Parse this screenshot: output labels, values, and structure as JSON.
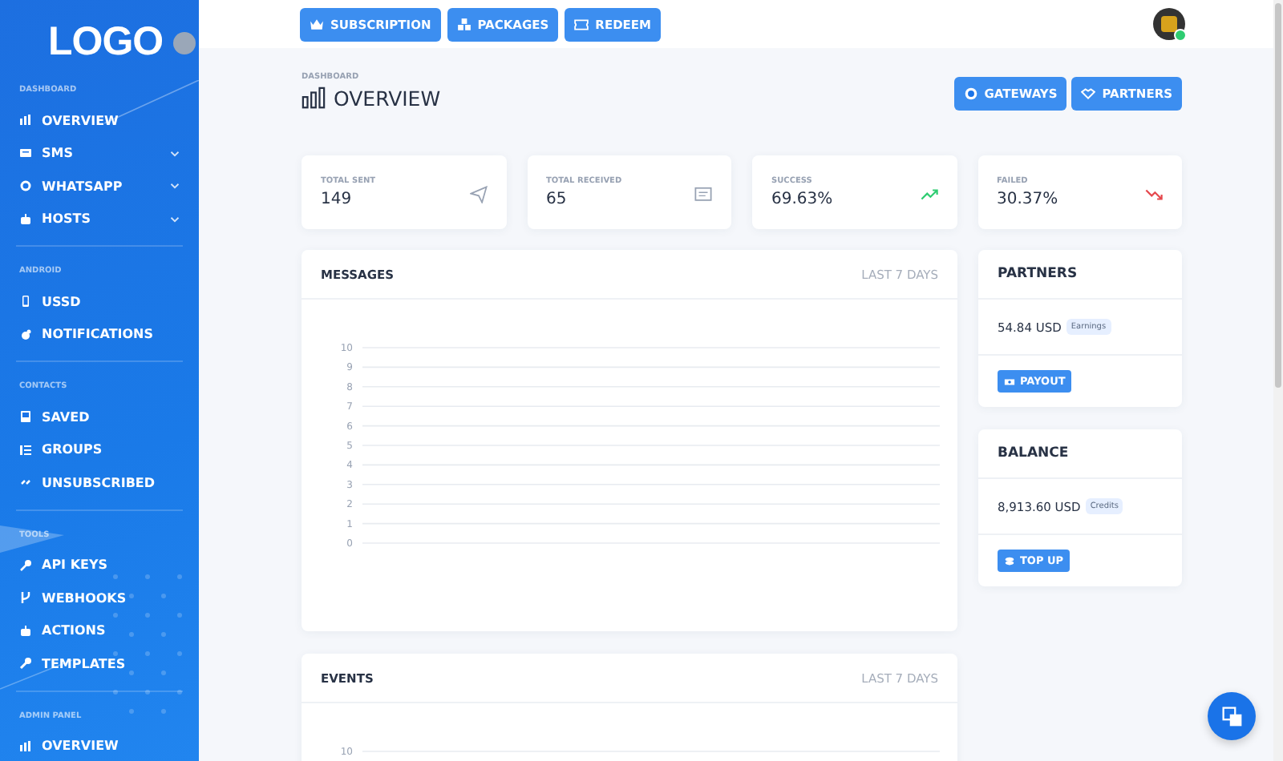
{
  "sidebar": {
    "logo": "LOGO",
    "sections": [
      {
        "title": "DASHBOARD",
        "items": [
          {
            "label": "OVERVIEW"
          },
          {
            "label": "SMS",
            "expanded": false
          },
          {
            "label": "WHATSAPP",
            "expanded": false
          },
          {
            "label": "HOSTS",
            "expanded": false
          }
        ]
      },
      {
        "title": "ANDROID",
        "items": [
          {
            "label": "USSD"
          },
          {
            "label": "NOTIFICATIONS"
          }
        ]
      },
      {
        "title": "CONTACTS",
        "items": [
          {
            "label": "SAVED"
          },
          {
            "label": "GROUPS"
          },
          {
            "label": "UNSUBSCRIBED"
          }
        ]
      },
      {
        "title": "TOOLS",
        "items": [
          {
            "label": "API KEYS"
          },
          {
            "label": "WEBHOOKS"
          },
          {
            "label": "ACTIONS"
          },
          {
            "label": "TEMPLATES"
          }
        ]
      },
      {
        "title": "ADMIN PANEL",
        "items": [
          {
            "label": "OVERVIEW"
          }
        ]
      }
    ]
  },
  "topbar": {
    "buttons": [
      "SUBSCRIPTION",
      "PACKAGES",
      "REDEEM"
    ],
    "user": {
      "online": true
    }
  },
  "header": {
    "breadcrumb": "DASHBOARD",
    "title": "OVERVIEW",
    "buttons": [
      "GATEWAYS",
      "PARTNERS"
    ]
  },
  "stats": [
    {
      "label": "TOTAL SENT",
      "value": "149",
      "kind": "sent"
    },
    {
      "label": "TOTAL RECEIVED",
      "value": "65",
      "kind": "received"
    },
    {
      "label": "SUCCESS",
      "value": "69.63%",
      "kind": "up"
    },
    {
      "label": "FAILED",
      "value": "30.37%",
      "kind": "down"
    }
  ],
  "messages": {
    "title": "MESSAGES",
    "period": "LAST 7 DAYS",
    "chart_data": {
      "type": "line",
      "categories": [
        null,
        null,
        null,
        null,
        null,
        null,
        null
      ],
      "values": [
        null,
        null,
        null,
        null,
        null,
        null,
        null
      ],
      "ylim": [
        0,
        10
      ],
      "yticks": [
        0,
        1,
        2,
        3,
        4,
        5,
        6,
        7,
        8,
        9,
        10
      ],
      "grid": true
    }
  },
  "events": {
    "title": "EVENTS",
    "period": "LAST 7 DAYS",
    "axis_tick": "10"
  },
  "partners": {
    "title": "PARTNERS",
    "amount": "54.84 USD",
    "tag": "Earnings",
    "button": "PAYOUT"
  },
  "balance": {
    "title": "BALANCE",
    "amount": "8,913.60 USD",
    "tag": "Credits",
    "button": "TOP UP"
  }
}
